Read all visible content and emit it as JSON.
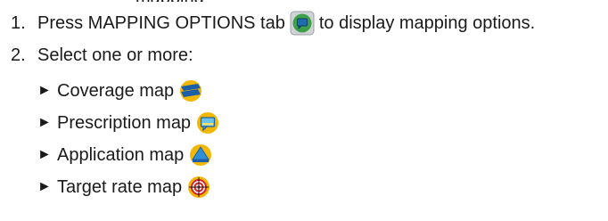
{
  "header_clip": "mapping",
  "steps": [
    {
      "number": "1.",
      "before": "Press MAPPING OPTIONS tab",
      "after": "to display mapping options.",
      "icon": "mapping-options-tab-icon"
    },
    {
      "number": "2.",
      "text": "Select one or more:"
    }
  ],
  "options": [
    {
      "arrow": "►",
      "label": "Coverage map",
      "icon": "coverage-map-icon"
    },
    {
      "arrow": "►",
      "label": "Prescription map",
      "icon": "prescription-map-icon"
    },
    {
      "arrow": "►",
      "label": "Application map",
      "icon": "application-map-icon"
    },
    {
      "arrow": "►",
      "label": "Target rate map",
      "icon": "target-rate-map-icon"
    }
  ],
  "colors": {
    "tab_green": "#3ea04a",
    "tab_blue": "#1f6fb0",
    "gold": "#f2b705",
    "blue": "#1c5fa8",
    "red": "#d2232a"
  }
}
